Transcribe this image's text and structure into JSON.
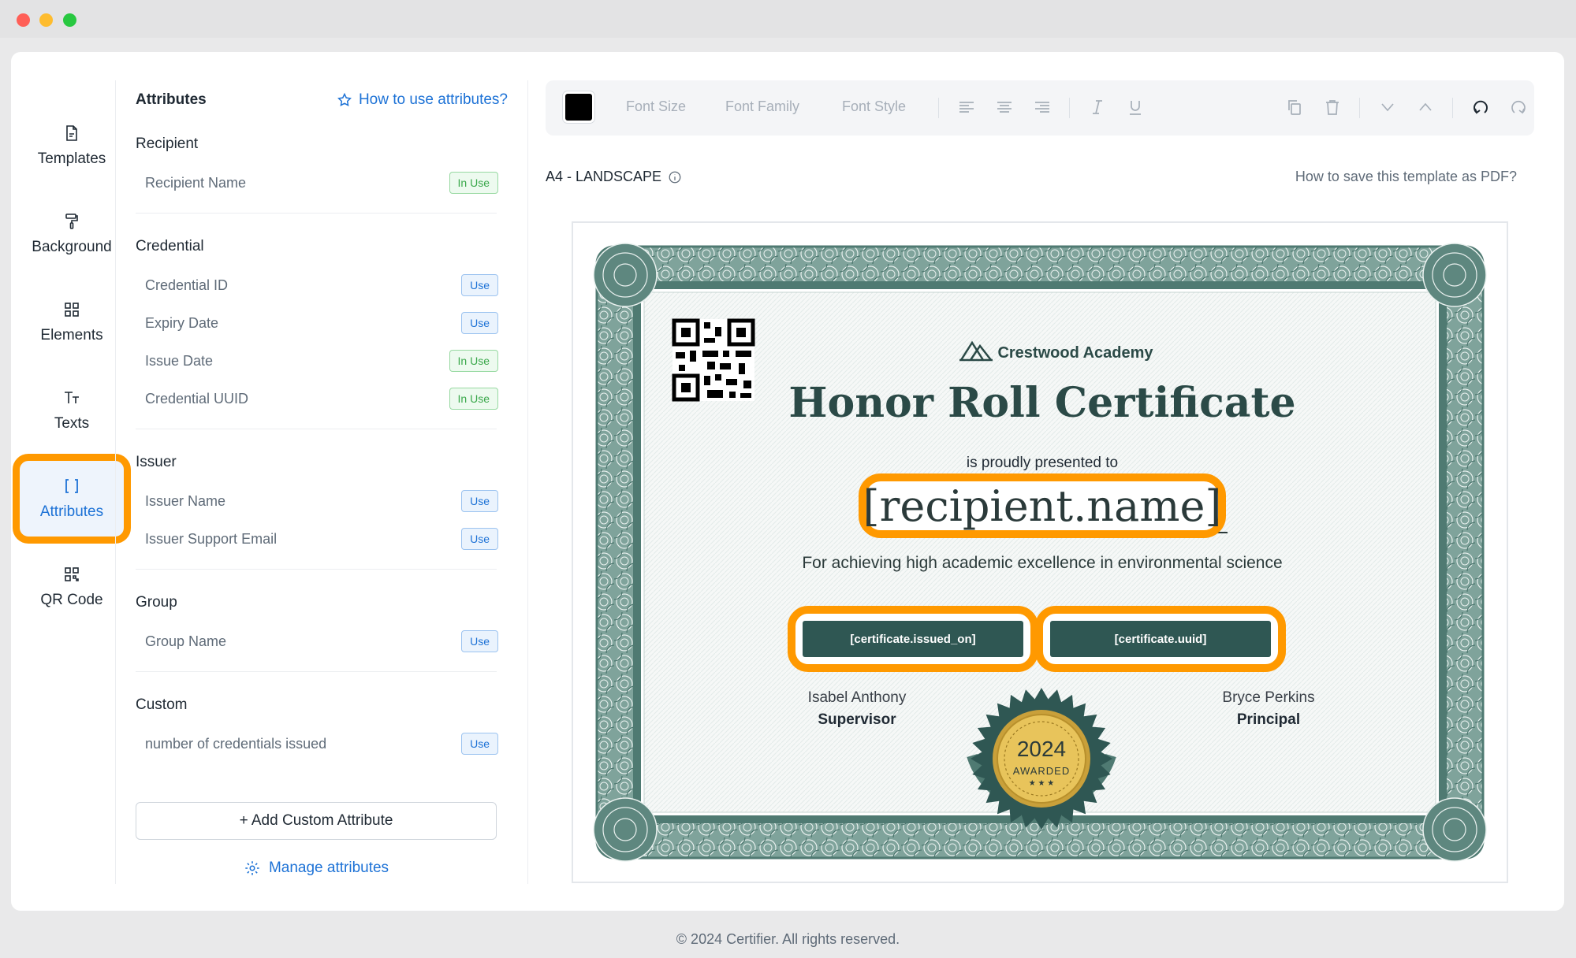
{
  "nav": [
    {
      "label": "Templates",
      "icon": "file-icon"
    },
    {
      "label": "Background",
      "icon": "paint-roller-icon"
    },
    {
      "label": "Elements",
      "icon": "grid-icon"
    },
    {
      "label": "Texts",
      "icon": "text-icon"
    },
    {
      "label": "Attributes",
      "icon": "brackets-icon",
      "active": true
    },
    {
      "label": "QR Code",
      "icon": "qr-icon"
    }
  ],
  "panel": {
    "title": "Attributes",
    "help_link": "How to use attributes?",
    "sections": [
      {
        "title": "Recipient",
        "rows": [
          {
            "name": "Recipient Name",
            "status": "In Use"
          }
        ]
      },
      {
        "title": "Credential",
        "rows": [
          {
            "name": "Credential ID",
            "status": "Use"
          },
          {
            "name": "Expiry Date",
            "status": "Use"
          },
          {
            "name": "Issue Date",
            "status": "In Use"
          },
          {
            "name": "Credential UUID",
            "status": "In Use"
          }
        ]
      },
      {
        "title": "Issuer",
        "rows": [
          {
            "name": "Issuer Name",
            "status": "Use"
          },
          {
            "name": "Issuer Support Email",
            "status": "Use"
          }
        ]
      },
      {
        "title": "Group",
        "rows": [
          {
            "name": "Group Name",
            "status": "Use"
          }
        ]
      },
      {
        "title": "Custom",
        "rows": [
          {
            "name": "number of credentials issued",
            "status": "Use"
          }
        ]
      }
    ],
    "add_button": "+  Add Custom Attribute",
    "manage_link": "Manage attributes"
  },
  "toolbar": {
    "color": "#000000",
    "font_size": "Font Size",
    "font_family": "Font Family",
    "font_style": "Font Style"
  },
  "canvas": {
    "size_label": "A4 - LANDSCAPE",
    "save_help": "How to save this template as PDF?"
  },
  "certificate": {
    "academy": "Crestwood Academy",
    "title": "Honor Roll Certificate",
    "presented": "is proudly presented to",
    "recipient": "[recipient.name]",
    "achievement": "For achieving high academic excellence in environmental science",
    "issued_on": "[certificate.issued_on]",
    "uuid": "[certificate.uuid]",
    "signer_left_name": "Isabel Anthony",
    "signer_left_role": "Supervisor",
    "signer_right_name": "Bryce Perkins",
    "signer_right_role": "Principal",
    "seal_year": "2024",
    "seal_text": "AWARDED",
    "seal_stars": "★ ★ ★",
    "frame_color": "#4f7a72",
    "accent_color": "#2f5753",
    "highlight_color": "#ff9900"
  },
  "footer": "© 2024 Certifier. All rights reserved."
}
